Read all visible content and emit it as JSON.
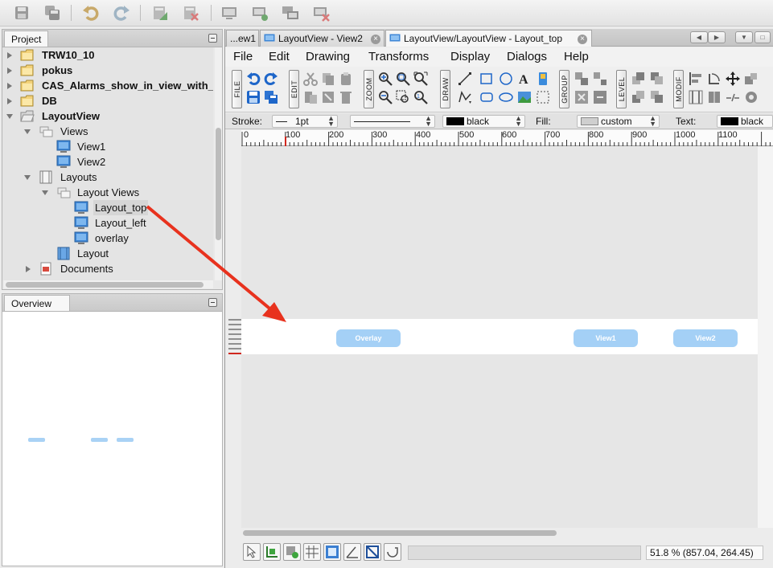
{
  "toolbar": {
    "icons": [
      "save-icon",
      "save-all-icon",
      "undo-icon",
      "redo-icon",
      "import-icon",
      "export-icon",
      "monitor-icon",
      "add-monitor-icon",
      "monitors-icon",
      "remove-monitor-icon"
    ]
  },
  "project_panel": {
    "tab_label": "Project",
    "tree": [
      {
        "label": "TRW10_10"
      },
      {
        "label": "pokus"
      },
      {
        "label": "CAS_Alarms_show_in_view_with_"
      },
      {
        "label": "DB"
      },
      {
        "label": "LayoutView"
      },
      {
        "label": "Views"
      },
      {
        "label": "View1"
      },
      {
        "label": "View2"
      },
      {
        "label": "Layouts"
      },
      {
        "label": "Layout Views"
      },
      {
        "label": "Layout_top"
      },
      {
        "label": "Layout_left"
      },
      {
        "label": "overlay"
      },
      {
        "label": "Layout"
      },
      {
        "label": "Documents"
      }
    ]
  },
  "overview_panel": {
    "tab_label": "Overview"
  },
  "editor": {
    "tabs": [
      {
        "label": "...ew1"
      },
      {
        "label": "LayoutView - View2"
      },
      {
        "label": "LayoutView/LayoutView - Layout_top"
      }
    ],
    "menu": [
      "File",
      "Edit",
      "Drawing",
      "Transforms",
      "Display",
      "Dialogs",
      "Help"
    ],
    "groups": [
      "FILE",
      "EDIT",
      "ZOOM",
      "DRAW",
      "GROUP",
      "LEVEL",
      "MODIF"
    ],
    "props": {
      "stroke_label": "Stroke:",
      "stroke_width": "1pt",
      "stroke_color": "black",
      "fill_label": "Fill:",
      "fill_value": "custom",
      "text_label": "Text:",
      "text_color": "black"
    },
    "ruler": [
      "0",
      "100",
      "200",
      "300",
      "400",
      "500",
      "600",
      "700",
      "800",
      "900",
      "1000",
      "1100"
    ],
    "canvas_buttons": [
      "Overlay",
      "View1",
      "View2"
    ],
    "status": {
      "zoom_coords": "51.8 % (857.04, 264.45)"
    }
  },
  "colors": {
    "accent_button": "#a4d0f6",
    "arrow": "#e8321e"
  }
}
